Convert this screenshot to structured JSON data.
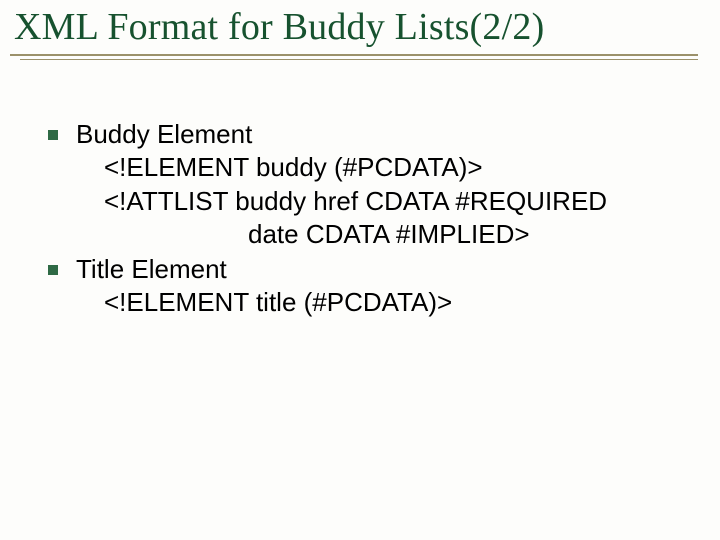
{
  "slide": {
    "title": "XML Format for Buddy Lists(2/2)",
    "items": [
      {
        "heading": "Buddy Element",
        "lines": [
          "<!ELEMENT buddy (#PCDATA)>",
          "<!ATTLIST buddy href CDATA #REQUIRED",
          "date CDATA #IMPLIED>"
        ]
      },
      {
        "heading": "Title Element",
        "lines": [
          "<!ELEMENT title (#PCDATA)>"
        ]
      }
    ]
  }
}
